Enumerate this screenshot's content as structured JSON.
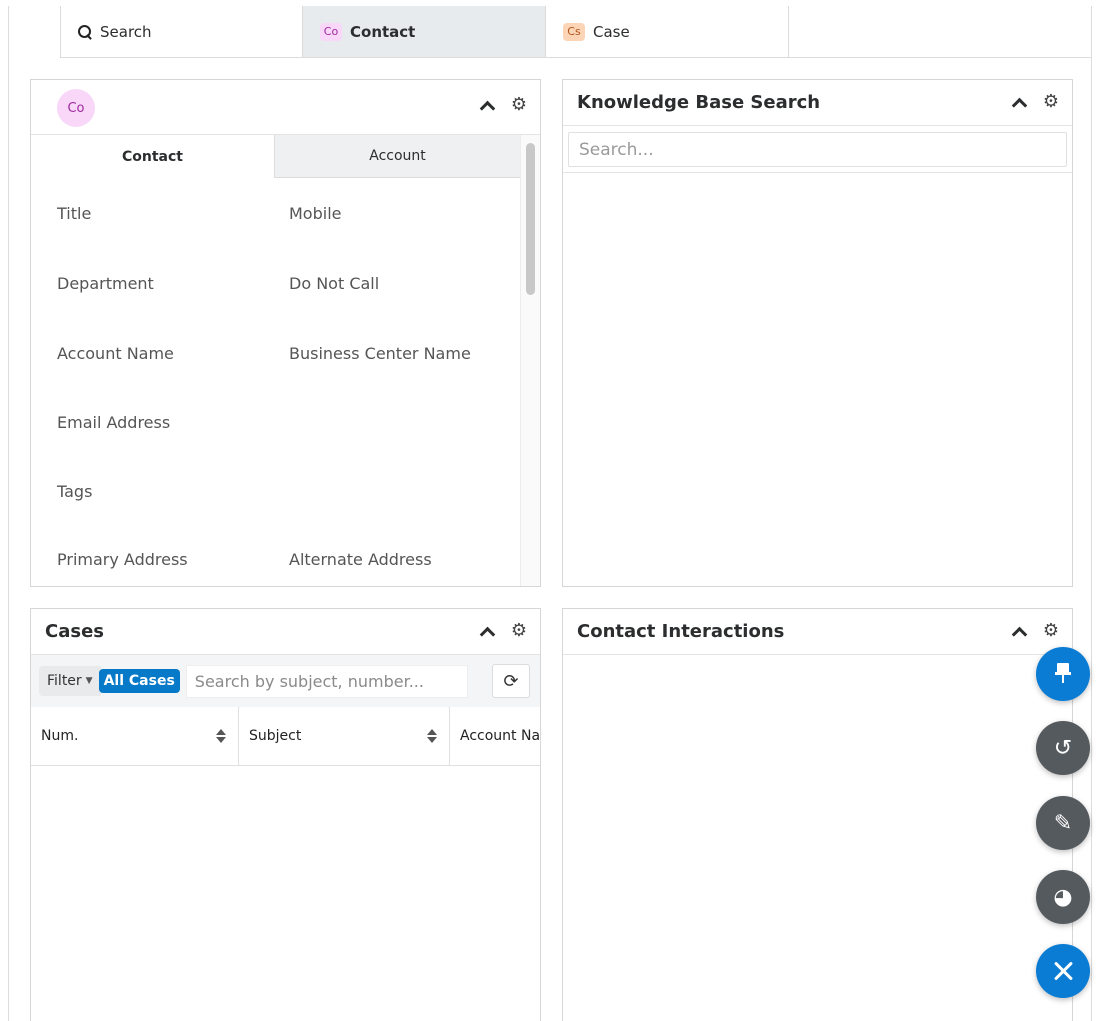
{
  "tabs": [
    {
      "label": "Search",
      "icon": "search-icon"
    },
    {
      "label": "Contact",
      "badge": "Co",
      "active": true
    },
    {
      "label": "Case",
      "badge": "Cs"
    }
  ],
  "contact_dashlet": {
    "avatar": "Co",
    "subtabs": [
      "Contact",
      "Account"
    ],
    "fields": [
      [
        "Title",
        "Mobile"
      ],
      [
        "Department",
        "Do Not Call"
      ],
      [
        "Account Name",
        "Business Center Name"
      ],
      [
        "Email Address",
        ""
      ],
      [
        "Tags",
        ""
      ],
      [
        "Primary Address",
        "Alternate Address"
      ]
    ]
  },
  "kb_dashlet": {
    "title": "Knowledge Base Search",
    "search_placeholder": "Search..."
  },
  "cases_dashlet": {
    "title": "Cases",
    "filter_label": "Filter",
    "filter_value": "All Cases",
    "search_placeholder": "Search by subject, number...",
    "columns": [
      "Num.",
      "Subject",
      "Account Na"
    ]
  },
  "interactions_dashlet": {
    "title": "Contact Interactions"
  },
  "colors": {
    "accent": "#0a7cd4",
    "fab_gray": "#555a5e",
    "contact_badge": "#f8d7f8",
    "case_badge": "#fbd5b5"
  },
  "fabs": [
    "pin-icon",
    "undo-icon",
    "pencil-icon",
    "pie-chart-icon",
    "close-icon"
  ]
}
